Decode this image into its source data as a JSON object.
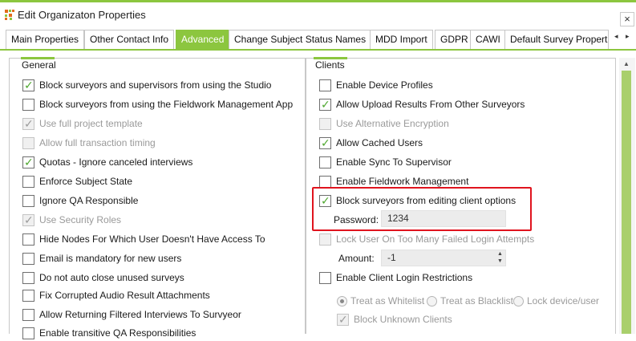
{
  "window": {
    "title": "Edit Organizaton Properties",
    "close_glyph": "×",
    "icon": "app-grid-icon"
  },
  "tabs": [
    {
      "label": "Main Properties",
      "active": false
    },
    {
      "label": "Other Contact Info",
      "active": false
    },
    {
      "label": "Advanced",
      "active": true
    },
    {
      "label": "Change Subject Status Names",
      "active": false
    },
    {
      "label": "MDD Import",
      "active": false
    },
    {
      "label": "GDPR",
      "active": false
    },
    {
      "label": "CAWI",
      "active": false
    },
    {
      "label": "Default Survey Properti",
      "active": false
    }
  ],
  "tab_scroll": {
    "left": "◂",
    "right": "▸"
  },
  "general": {
    "header": "General",
    "items": [
      {
        "label": "Block surveyors and supervisors from using the Studio",
        "checked": true,
        "disabled": false
      },
      {
        "label": "Block surveyors from using the  Fieldwork Management App",
        "checked": false,
        "disabled": false
      },
      {
        "label": "Use full project template",
        "checked": true,
        "disabled": true
      },
      {
        "label": "Allow full transaction timing",
        "checked": false,
        "disabled": true
      },
      {
        "label": "Quotas - Ignore canceled interviews",
        "checked": true,
        "disabled": false
      },
      {
        "label": "Enforce Subject State",
        "checked": false,
        "disabled": false
      },
      {
        "label": "Ignore QA Responsible",
        "checked": false,
        "disabled": false
      },
      {
        "label": "Use Security Roles",
        "checked": true,
        "disabled": true
      },
      {
        "label": "Hide Nodes For Which User Doesn't Have Access To",
        "checked": false,
        "disabled": false
      },
      {
        "label": "Email is mandatory for new users",
        "checked": false,
        "disabled": false
      },
      {
        "label": "Do not auto close unused surveys",
        "checked": false,
        "disabled": false
      },
      {
        "label": "Fix Corrupted Audio Result Attachments",
        "checked": false,
        "disabled": false
      },
      {
        "label": "Allow Returning Filtered Interviews To Survyeor",
        "checked": false,
        "disabled": false
      },
      {
        "label": "Enable transitive QA Responsibilities",
        "checked": false,
        "disabled": false
      }
    ]
  },
  "clients": {
    "header": "Clients",
    "items": [
      {
        "label": "Enable Device Profiles",
        "checked": false,
        "disabled": false
      },
      {
        "label": "Allow Upload Results From Other Surveyors",
        "checked": true,
        "disabled": false
      },
      {
        "label": "Use Alternative Encryption",
        "checked": false,
        "disabled": true
      },
      {
        "label": "Allow Cached Users",
        "checked": true,
        "disabled": false
      },
      {
        "label": "Enable Sync To Supervisor",
        "checked": false,
        "disabled": false
      },
      {
        "label": "Enable Fieldwork Management",
        "checked": false,
        "disabled": false
      },
      {
        "label": "Block surveyors from editing client options",
        "checked": true,
        "disabled": false
      }
    ],
    "password_label": "Password:",
    "password_value": "1234",
    "lock_user": {
      "label": "Lock User On Too Many Failed Login Attempts",
      "checked": false,
      "disabled": true
    },
    "amount_label": "Amount:",
    "amount_value": "-1",
    "spin_up": "▲",
    "spin_down": "▼",
    "login_restrictions": {
      "label": "Enable Client Login Restrictions",
      "checked": false,
      "disabled": false
    },
    "radios": [
      {
        "label": "Treat as Whitelist",
        "selected": true
      },
      {
        "label": "Treat as Blacklist",
        "selected": false
      },
      {
        "label": "Lock device/user",
        "selected": false
      }
    ],
    "block_unknown": {
      "label": "Block Unknown Clients",
      "checked": true,
      "disabled": true
    }
  },
  "check_glyph": "✓",
  "scroll_up_glyph": "▲",
  "colors": {
    "accent": "#8cc63f",
    "highlight": "#e0141e",
    "check": "#4ea72e"
  }
}
